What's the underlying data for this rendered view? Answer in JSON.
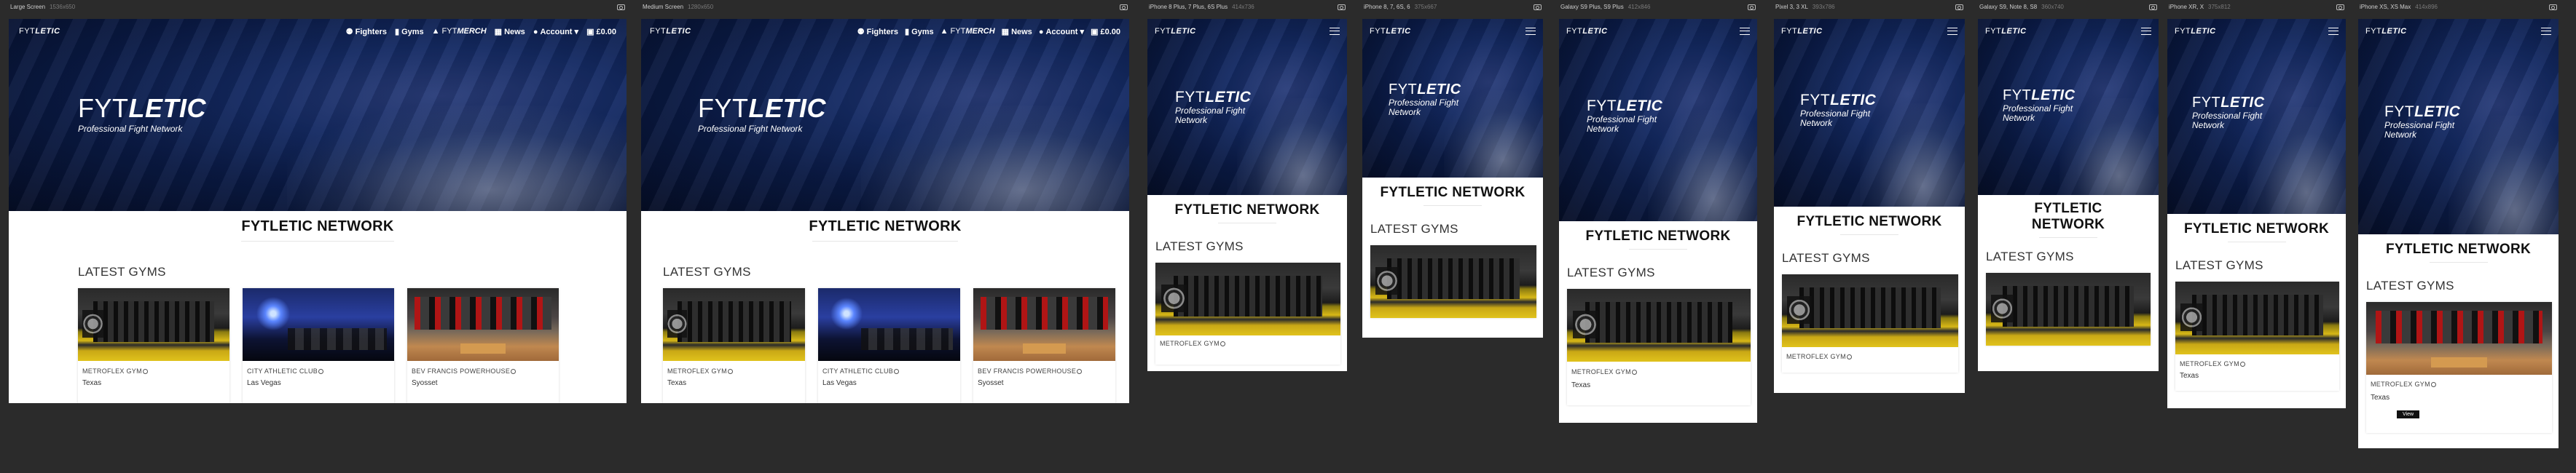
{
  "site": {
    "logo_light": "FYT",
    "logo_bold": "LETIC",
    "tagline": "Professional Fight Network",
    "nav": {
      "fighters": "Fighters",
      "gyms": "Gyms",
      "merch_light": "FYT",
      "merch_bold": "MERCH",
      "news": "News",
      "account": "Account",
      "cart": "£0.00"
    },
    "network_title": "FYTLETIC NETWORK",
    "latest_gyms": "LATEST GYMS",
    "view_label": "View"
  },
  "gyms": [
    {
      "name": "METROFLEX GYM",
      "location": "Texas"
    },
    {
      "name": "CITY ATHLETIC CLUB",
      "location": "Las Vegas"
    },
    {
      "name": "BEV FRANCIS POWERHOUSE",
      "location": "Syosset"
    }
  ],
  "frames": [
    {
      "label": "Large Screen",
      "size": "1536x650"
    },
    {
      "label": "Medium Screen",
      "size": "1280x650"
    },
    {
      "label": "iPhone 8 Plus, 7 Plus, 6S Plus",
      "size": "414x736"
    },
    {
      "label": "iPhone 8, 7, 6S, 6",
      "size": "375x667"
    },
    {
      "label": "Galaxy S9 Plus, S9 Plus",
      "size": "412x846"
    },
    {
      "label": "Pixel 3, 3 XL",
      "size": "393x786"
    },
    {
      "label": "Galaxy S9, Note 8, S8",
      "size": "360x740"
    },
    {
      "label": "iPhone XR, X",
      "size": "375x812"
    },
    {
      "label": "iPhone XS, XS Max",
      "size": "414x896"
    }
  ],
  "colors": {
    "hero_navy": "#0a1a45",
    "page_bg": "#2b2b2b",
    "gym_yellow": "#d8b816"
  }
}
